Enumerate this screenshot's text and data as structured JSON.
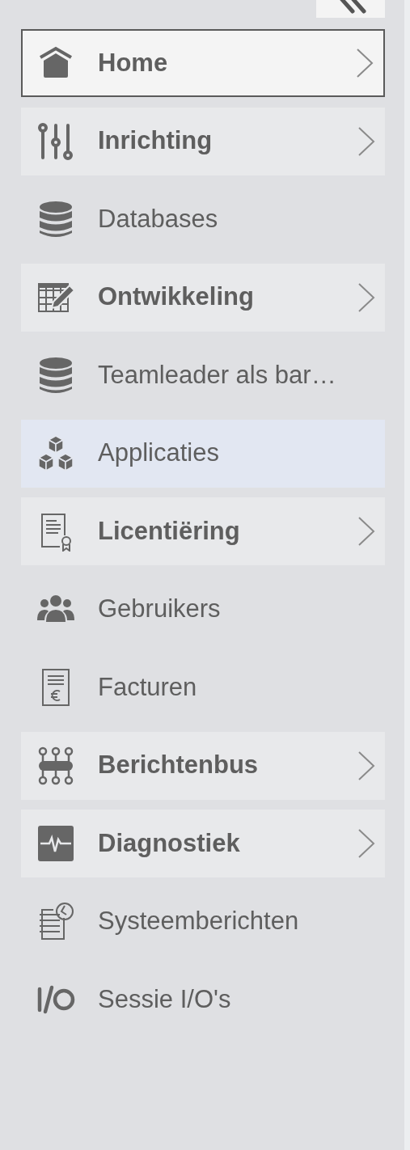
{
  "collapse_button": {
    "kind": "collapse"
  },
  "menu_items": [
    {
      "label": "Home",
      "kind": "group",
      "focused": true,
      "selected": false
    },
    {
      "label": "Inrichting",
      "kind": "group",
      "focused": false,
      "selected": false
    },
    {
      "label": "Databases",
      "kind": "link",
      "focused": false,
      "selected": false
    },
    {
      "label": "Ontwikkeling",
      "kind": "group",
      "focused": false,
      "selected": false
    },
    {
      "label": "Teamleader als bar…",
      "kind": "link",
      "focused": false,
      "selected": false
    },
    {
      "label": "Applicaties",
      "kind": "link",
      "focused": false,
      "selected": true
    },
    {
      "label": "Licentiëring",
      "kind": "group",
      "focused": false,
      "selected": false
    },
    {
      "label": "Gebruikers",
      "kind": "link",
      "focused": false,
      "selected": false
    },
    {
      "label": "Facturen",
      "kind": "link",
      "focused": false,
      "selected": false
    },
    {
      "label": "Berichtenbus",
      "kind": "group",
      "focused": false,
      "selected": false
    },
    {
      "label": "Diagnostiek",
      "kind": "group",
      "focused": false,
      "selected": false
    },
    {
      "label": "Systeemberichten",
      "kind": "link",
      "focused": false,
      "selected": false
    },
    {
      "label": "Sessie I/O's",
      "kind": "link",
      "focused": false,
      "selected": false
    }
  ]
}
